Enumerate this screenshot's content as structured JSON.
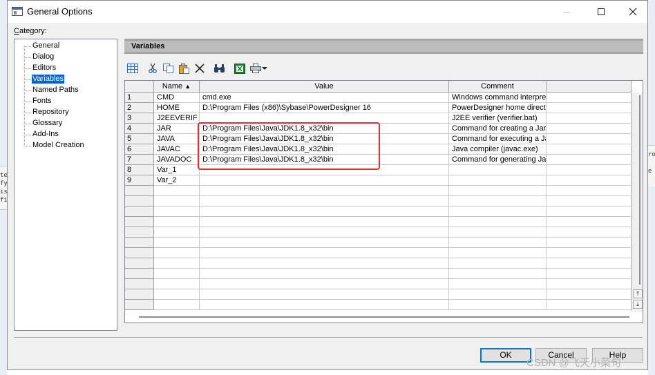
{
  "window": {
    "title": "General Options"
  },
  "background": {
    "left_text": "te\nfy\nis\nfi",
    "right_text": "ro\n\ne C"
  },
  "category": {
    "label": "Category:",
    "items": [
      {
        "label": "General",
        "selected": false
      },
      {
        "label": "Dialog",
        "selected": false
      },
      {
        "label": "Editors",
        "selected": false
      },
      {
        "label": "Variables",
        "selected": true
      },
      {
        "label": "Named Paths",
        "selected": false
      },
      {
        "label": "Fonts",
        "selected": false
      },
      {
        "label": "Repository",
        "selected": false
      },
      {
        "label": "Glossary",
        "selected": false
      },
      {
        "label": "Add-Ins",
        "selected": false
      },
      {
        "label": "Model Creation",
        "selected": false
      }
    ]
  },
  "section": {
    "title": "Variables"
  },
  "toolbar": {
    "icons": [
      "grid-properties-icon",
      "cut-icon",
      "copy-icon",
      "paste-icon",
      "delete-icon",
      "find-icon",
      "excel-export-icon",
      "print-icon",
      "dropdown-arrow-icon"
    ]
  },
  "grid": {
    "columns": {
      "name": "Name",
      "value": "Value",
      "comment": "Comment"
    },
    "sort_indicator": "▲",
    "rows": [
      {
        "num": "1",
        "name": "CMD",
        "value": "cmd.exe",
        "comment": "Windows command interpret"
      },
      {
        "num": "2",
        "name": "HOME",
        "value": "D:\\Program Files (x86)\\Sybase\\PowerDesigner 16",
        "comment": "PowerDesigner home direct"
      },
      {
        "num": "3",
        "name": "J2EEVERIF",
        "value": "",
        "comment": "J2EE verifier (verifier.bat)"
      },
      {
        "num": "4",
        "name": "JAR",
        "value": "D:\\Program Files\\Java\\JDK1.8_x32\\bin",
        "comment": "Command for creating a Jar f"
      },
      {
        "num": "5",
        "name": "JAVA",
        "value": "D:\\Program Files\\Java\\JDK1.8_x32\\bin",
        "comment": "Command for executing a Ja"
      },
      {
        "num": "6",
        "name": "JAVAC",
        "value": "D:\\Program Files\\Java\\JDK1.8_x32\\bin",
        "comment": "Java compiler (javac.exe)"
      },
      {
        "num": "7",
        "name": "JAVADOC",
        "value": "D:\\Program Files\\Java\\JDK1.8_x32\\bin",
        "comment": "Command for generating Jav"
      },
      {
        "num": "8",
        "name": "Var_1",
        "value": "",
        "comment": ""
      },
      {
        "num": "9",
        "name": "Var_2",
        "value": "",
        "comment": ""
      }
    ],
    "empty_rows": 12
  },
  "buttons": {
    "ok": "OK",
    "cancel": "Cancel",
    "help": "Help"
  },
  "watermark": "CSDN @飞天小菜句",
  "colors": {
    "selection": "#0a5fd0",
    "highlight": "#e0312f",
    "header_bar": "#bcbcbc"
  }
}
